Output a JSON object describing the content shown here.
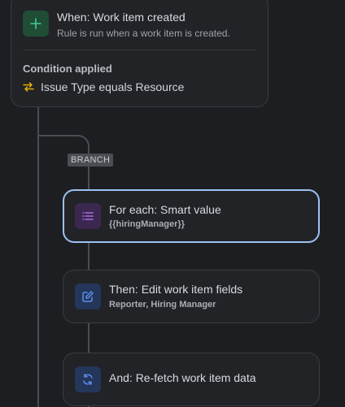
{
  "trigger": {
    "title": "When: Work item created",
    "subtitle": "Rule is run when a work item is created.",
    "icon": "plus-icon",
    "condition_heading": "Condition applied",
    "condition_text": "Issue Type equals Resource",
    "condition_icon": "swap-arrows-icon"
  },
  "branch": {
    "badge": "BRANCH",
    "for_each_title": "For each: Smart value",
    "for_each_value": "{{hiringManager}}",
    "then_title": "Then: Edit work item fields",
    "then_field_1": "Reporter",
    "then_sep": ",",
    "then_field_2": "Hiring Manager",
    "and_title": "And: Re-fetch work item data"
  },
  "colors": {
    "background": "#1d1e21",
    "card": "#222327",
    "selected_border": "#9cc1f2",
    "trigger_icon": "#2bb673",
    "list_icon": "#a76de3",
    "edit_icon": "#5b8def",
    "refresh_icon": "#5b8def",
    "condition_icon": "#e2b203"
  }
}
